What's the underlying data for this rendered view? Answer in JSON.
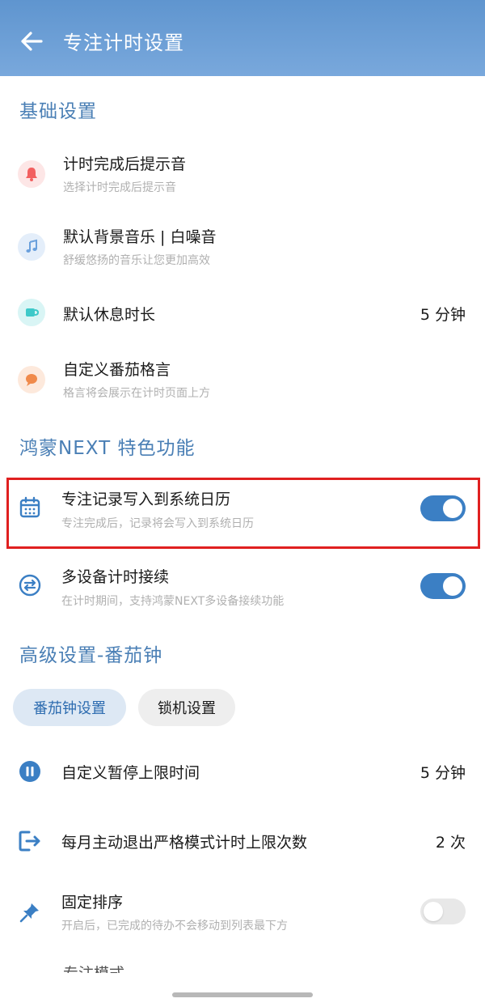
{
  "header": {
    "title": "专注计时设置"
  },
  "sections": {
    "basic": "基础设置",
    "harmony": "鸿蒙NEXT 特色功能",
    "advanced": "高级设置-番茄钟"
  },
  "basic_items": [
    {
      "title": "计时完成后提示音",
      "subtitle": "选择计时完成后提示音",
      "icon": "bell-icon"
    },
    {
      "title": "默认背景音乐 | 白噪音",
      "subtitle": "舒缓悠扬的音乐让您更加高效",
      "icon": "music-note-icon"
    },
    {
      "title": "默认休息时长",
      "value": "5 分钟",
      "icon": "coffee-cup-icon"
    },
    {
      "title": "自定义番茄格言",
      "subtitle": "格言将会展示在计时页面上方",
      "icon": "speech-bubble-icon"
    }
  ],
  "harmony_items": [
    {
      "title": "专注记录写入到系统日历",
      "subtitle": "专注完成后，记录将会写入到系统日历",
      "icon": "calendar-icon",
      "enabled": true
    },
    {
      "title": "多设备计时接续",
      "subtitle": "在计时期间，支持鸿蒙NEXT多设备接续功能",
      "icon": "sync-arrows-icon",
      "enabled": true
    }
  ],
  "tabs": [
    {
      "label": "番茄钟设置",
      "active": true
    },
    {
      "label": "锁机设置",
      "active": false
    }
  ],
  "advanced_items": [
    {
      "title": "自定义暂停上限时间",
      "value": "5 分钟",
      "icon": "pause-icon"
    },
    {
      "title": "每月主动退出严格模式计时上限次数",
      "value": "2 次",
      "icon": "exit-icon"
    },
    {
      "title": "固定排序",
      "subtitle": "开启后，已完成的待办不会移动到列表最下方",
      "icon": "pin-icon",
      "enabled": false
    }
  ],
  "partial_item": "专注模式",
  "colors": {
    "header": "#6a9dd5",
    "accent": "#3b7fc4",
    "section_title": "#4a7fb5",
    "highlight": "#e02020"
  }
}
